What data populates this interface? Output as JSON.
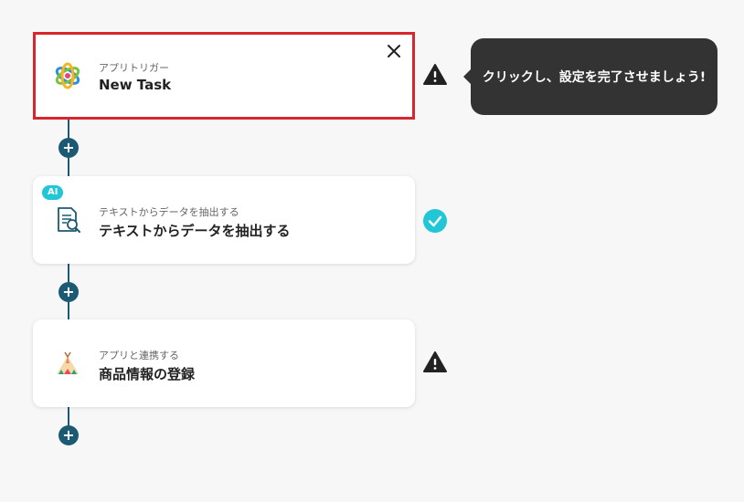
{
  "flow": {
    "steps": [
      {
        "subtitle": "アプリトリガー",
        "title": "New Task",
        "icon": "asana-logo-icon",
        "status": "warning"
      },
      {
        "badge": "AI",
        "subtitle": "テキストからデータを抽出する",
        "title": "テキストからデータを抽出する",
        "icon": "document-search-icon",
        "status": "complete"
      },
      {
        "subtitle": "アプリと連携する",
        "title": "商品情報の登録",
        "icon": "tipi-tent-icon",
        "status": "warning"
      }
    ],
    "add_step_label": "+"
  },
  "tooltip": {
    "text": "クリックし、設定を完了させましょう!"
  },
  "colors": {
    "connector": "#1c5a73",
    "selected_border": "#d9262c",
    "ai_badge": "#21c7d6",
    "check": "#21c7d6",
    "warning": "#222222",
    "tooltip_bg": "#333333"
  }
}
